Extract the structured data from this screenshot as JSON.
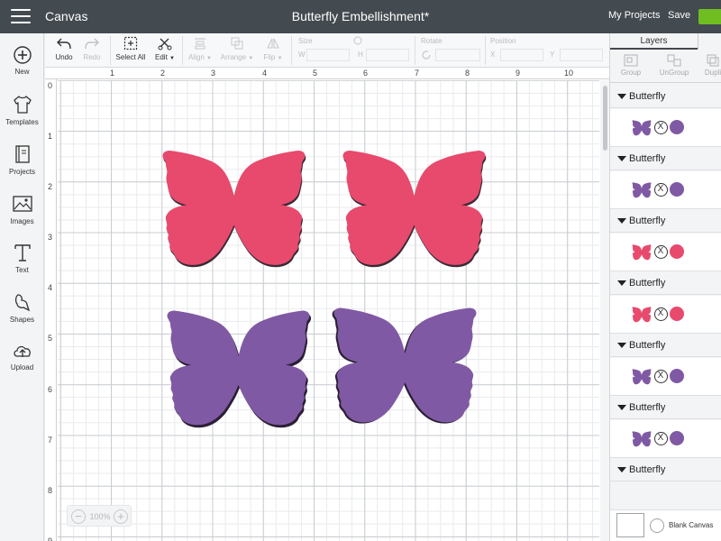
{
  "topbar": {
    "app_name": "Canvas",
    "doc_title": "Butterfly Embellishment*",
    "my_projects": "My Projects",
    "save": "Save"
  },
  "sidebar": {
    "items": [
      {
        "label": "New",
        "icon": "plus-circle-icon"
      },
      {
        "label": "Templates",
        "icon": "tshirt-icon"
      },
      {
        "label": "Projects",
        "icon": "book-icon"
      },
      {
        "label": "Images",
        "icon": "image-icon"
      },
      {
        "label": "Text",
        "icon": "text-t-icon"
      },
      {
        "label": "Shapes",
        "icon": "shapes-icon"
      },
      {
        "label": "Upload",
        "icon": "cloud-upload-icon"
      }
    ]
  },
  "toolbar": {
    "undo": "Undo",
    "redo": "Redo",
    "select_all": "Select All",
    "edit": "Edit",
    "align": "Align",
    "arrange": "Arrange",
    "flip": "Flip",
    "size": "Size",
    "w": "W",
    "h": "H",
    "rotate": "Rotate",
    "position": "Position",
    "x": "X",
    "y": "Y"
  },
  "canvas": {
    "ruler_x": [
      "1",
      "2",
      "3",
      "4",
      "5",
      "6",
      "7",
      "8",
      "9",
      "10"
    ],
    "ruler_y": [
      "0",
      "1",
      "2",
      "3",
      "4",
      "5",
      "6",
      "7",
      "8",
      "9"
    ],
    "zoom": "100%",
    "colors": {
      "pink": "#e74a6d",
      "purple": "#8059a4",
      "outline": "#3a2a35"
    }
  },
  "layers_panel": {
    "tab": "Layers",
    "tools": [
      "Group",
      "UnGroup",
      "Dupli"
    ],
    "groups": [
      {
        "name": "Butterfly",
        "color": "#8059a4",
        "op": "X"
      },
      {
        "name": "Butterfly",
        "color": "#8059a4",
        "op": "X"
      },
      {
        "name": "Butterfly",
        "color": "#e74a6d",
        "op": "X"
      },
      {
        "name": "Butterfly",
        "color": "#e74a6d",
        "op": "X"
      },
      {
        "name": "Butterfly",
        "color": "#8059a4",
        "op": "X"
      },
      {
        "name": "Butterfly",
        "color": "#8059a4",
        "op": "X"
      },
      {
        "name": "Butterfly",
        "color": "",
        "op": ""
      }
    ],
    "blank_canvas": "Blank Canvas"
  }
}
